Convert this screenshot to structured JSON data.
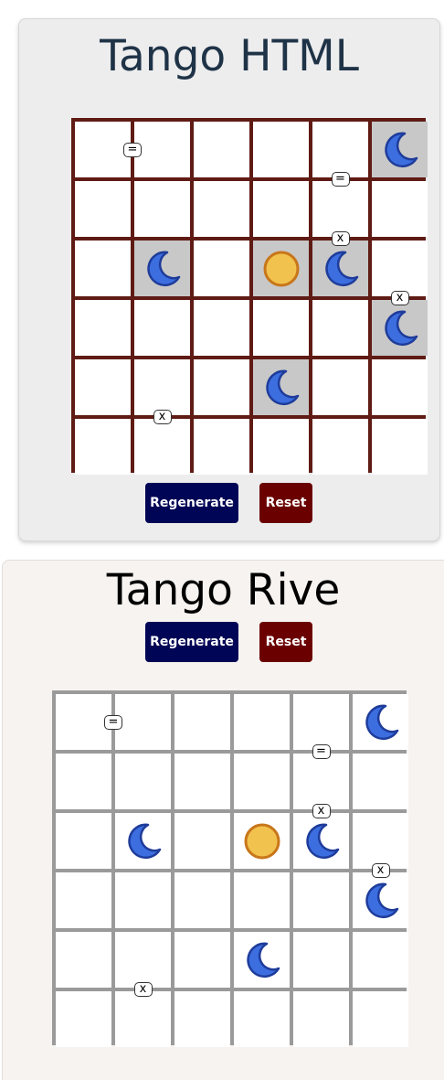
{
  "html_panel": {
    "title": "Tango HTML",
    "regenerate_label": "Regenerate",
    "reset_label": "Reset"
  },
  "rive_panel": {
    "title": "Tango Rive",
    "regenerate_label": "Regenerate",
    "reset_label": "Reset"
  },
  "colors": {
    "html_grid_line": "#5f1b14",
    "rive_grid_line": "#9a9a9a",
    "locked_cell": "#c8c8c8",
    "moon_fill": "#3d6ee0",
    "moon_stroke": "#1e3c9a",
    "sun_fill": "#f2c24e",
    "sun_stroke": "#c8761a",
    "regenerate_button": "#000555",
    "reset_button": "#6b0000"
  },
  "board": {
    "size": 6,
    "pieces": [
      {
        "row": 0,
        "col": 5,
        "symbol": "moon",
        "locked": true
      },
      {
        "row": 2,
        "col": 1,
        "symbol": "moon",
        "locked": true
      },
      {
        "row": 2,
        "col": 3,
        "symbol": "sun",
        "locked": true
      },
      {
        "row": 2,
        "col": 4,
        "symbol": "moon",
        "locked": true
      },
      {
        "row": 3,
        "col": 5,
        "symbol": "moon",
        "locked": true
      },
      {
        "row": 4,
        "col": 3,
        "symbol": "moon",
        "locked": true
      }
    ],
    "constraints": [
      {
        "between": [
          [
            0,
            0
          ],
          [
            0,
            1
          ]
        ],
        "symbol": "="
      },
      {
        "between": [
          [
            0,
            4
          ],
          [
            1,
            4
          ]
        ],
        "symbol": "="
      },
      {
        "between": [
          [
            1,
            4
          ],
          [
            2,
            4
          ]
        ],
        "symbol": "x"
      },
      {
        "between": [
          [
            2,
            5
          ],
          [
            3,
            5
          ]
        ],
        "symbol": "x"
      },
      {
        "between": [
          [
            4,
            1
          ],
          [
            5,
            1
          ]
        ],
        "symbol": "x"
      }
    ]
  }
}
